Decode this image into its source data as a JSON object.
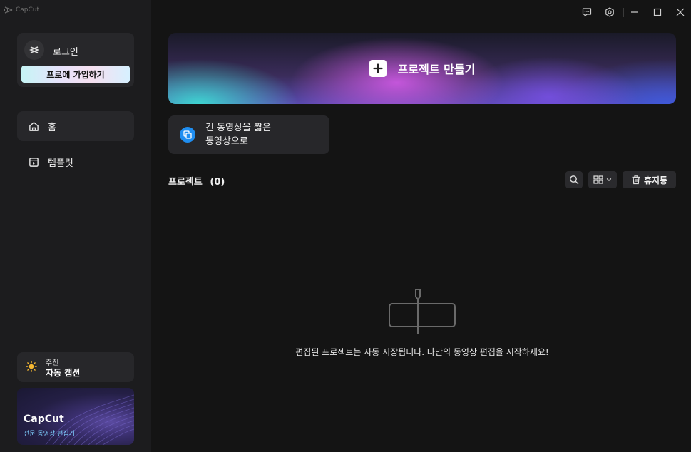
{
  "app": {
    "logo_text": "CapCut"
  },
  "sidebar": {
    "login": {
      "label": "로그인",
      "pro_button": "프로에 가입하기"
    },
    "nav": [
      {
        "label": "홈",
        "active": true,
        "icon": "home-icon"
      },
      {
        "label": "템플릿",
        "active": false,
        "icon": "template-icon"
      }
    ],
    "recommend": {
      "small": "추천",
      "title": "자동 캡션",
      "icon": "sun-icon"
    },
    "promo": {
      "title": "CapCut",
      "subtitle": "전문 동영상 편집기"
    }
  },
  "window_controls": [
    "feedback-icon",
    "settings-icon",
    "minimize-icon",
    "maximize-icon",
    "close-icon"
  ],
  "main": {
    "create_project": {
      "label": "프로젝트 만들기",
      "icon": "plus-icon"
    },
    "tool_card": {
      "line1": "긴 동영상을 짧은",
      "line2": "동영상으로",
      "icon": "clip-icon"
    },
    "projects": {
      "title": "프로젝트",
      "count": "(0)",
      "trash_label": "휴지통",
      "empty_message": "편집된 프로젝트는 자동 저장됩니다. 나만의 동영상 편집을 시작하세요!"
    }
  },
  "colors": {
    "sidebar_bg": "#1c1c1e",
    "main_bg": "#141414",
    "card_bg": "#27272a",
    "accent_blue": "#1f8ef1"
  }
}
